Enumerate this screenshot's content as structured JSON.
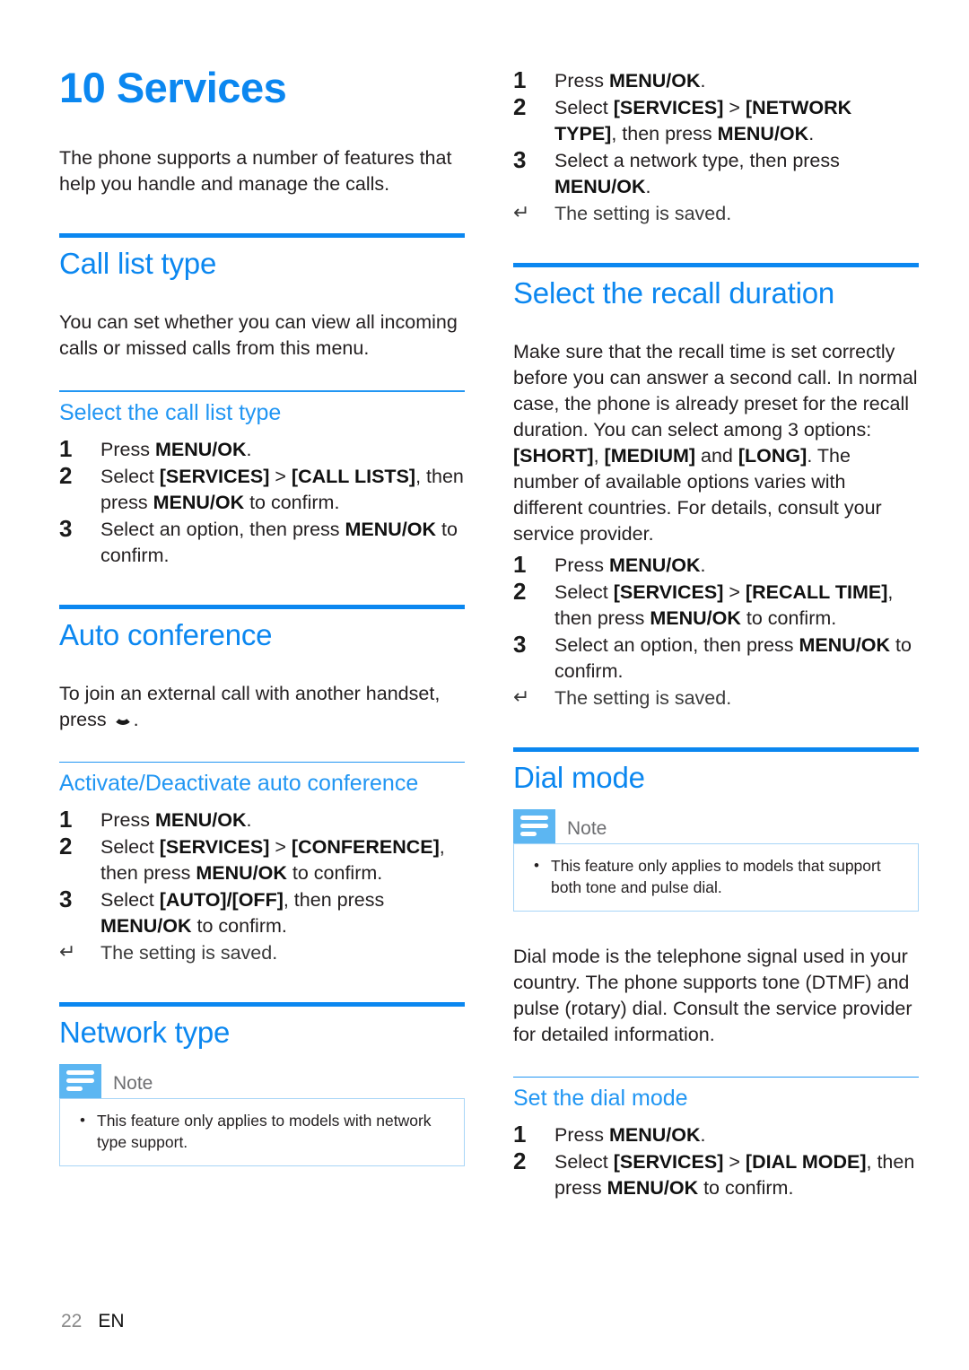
{
  "document": {
    "chapter_title": "10 Services",
    "intro": "The phone supports a number of features that help you handle and manage the calls."
  },
  "colors": {
    "heading_blue": "#0b87f0",
    "subheading_blue": "#2196f3",
    "note_tab_blue": "#5cb6f2",
    "note_border_blue": "#a8d5f7",
    "body_text": "#231f20"
  },
  "footer": {
    "page_number": "22",
    "language": "EN"
  },
  "note_label": "Note",
  "left_column": {
    "sections": [
      {
        "title": "Call list type",
        "body": "You can set whether you can view all incoming calls or missed calls from this menu.",
        "subsections": [
          {
            "title": "Select the call list type",
            "steps": [
              {
                "num": "1",
                "text": "Press MENU/OK."
              },
              {
                "num": "2",
                "text": "Select [SERVICES] > [CALL LISTS], then press MENU/OK to confirm."
              },
              {
                "num": "3",
                "text": "Select an option, then press MENU/OK to confirm."
              }
            ]
          }
        ]
      },
      {
        "title": "Auto conference",
        "body_prefix": "To join an external call with another handset, press ",
        "body_suffix": ".",
        "subsections": [
          {
            "title": "Activate/Deactivate auto conference",
            "steps": [
              {
                "num": "1",
                "text": "Press MENU/OK."
              },
              {
                "num": "2",
                "text": "Select [SERVICES] > [CONFERENCE], then press MENU/OK to confirm."
              },
              {
                "num": "3",
                "text": "Select [AUTO]/[OFF], then press MENU/OK to confirm."
              }
            ],
            "result": "The setting is saved."
          }
        ]
      },
      {
        "title": "Network type",
        "note": "This feature only applies to models with network type support."
      }
    ]
  },
  "right_column": {
    "network_type_steps": [
      {
        "num": "1",
        "text": "Press MENU/OK."
      },
      {
        "num": "2",
        "text": "Select [SERVICES] > [NETWORK TYPE], then press MENU/OK."
      },
      {
        "num": "3",
        "text": "Select a network type, then press MENU/OK."
      }
    ],
    "network_type_result": "The setting is saved.",
    "sections": [
      {
        "title": "Select the recall duration",
        "body": "Make sure that the recall time is set correctly before you can answer a second call. In normal case, the phone is already preset for the recall duration. You can select among 3 options: [SHORT], [MEDIUM] and [LONG]. The number of available options varies with different countries. For details, consult your service provider.",
        "steps": [
          {
            "num": "1",
            "text": "Press MENU/OK."
          },
          {
            "num": "2",
            "text": "Select [SERVICES] > [RECALL TIME], then press MENU/OK to confirm."
          },
          {
            "num": "3",
            "text": "Select an option, then press MENU/OK to confirm."
          }
        ],
        "result": "The setting is saved."
      },
      {
        "title": "Dial mode",
        "note": "This feature only applies to models that support both tone and pulse dial.",
        "body": "Dial mode is the telephone signal used in your country. The phone supports tone (DTMF) and pulse (rotary) dial. Consult the service provider for detailed information.",
        "subsections": [
          {
            "title": "Set the dial mode",
            "steps": [
              {
                "num": "1",
                "text": "Press MENU/OK."
              },
              {
                "num": "2",
                "text": "Select [SERVICES] > [DIAL MODE], then press MENU/OK to confirm."
              }
            ]
          }
        ]
      }
    ]
  }
}
